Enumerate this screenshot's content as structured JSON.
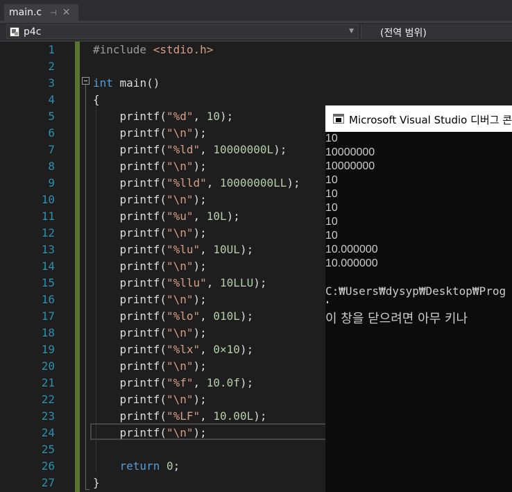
{
  "tab": {
    "filename": "main.c",
    "pin_glyph": "⊣",
    "close_glyph": "✕"
  },
  "nav": {
    "project": "p4c",
    "scope": "(전역 범위)"
  },
  "editor": {
    "line_numbers": [
      "1",
      "2",
      "3",
      "4",
      "5",
      "6",
      "7",
      "8",
      "9",
      "10",
      "11",
      "12",
      "13",
      "14",
      "15",
      "16",
      "17",
      "18",
      "19",
      "20",
      "21",
      "22",
      "23",
      "24",
      "25",
      "26",
      "27"
    ],
    "code": {
      "l1_pp": "#include ",
      "l1_file": "<stdio.h>",
      "l3_kw": "int",
      "l3_rest": " main()",
      "l4": "{",
      "printf": "printf",
      "l5_a": "(",
      "l5_str": "\"%d\"",
      "l5_b": ", ",
      "l5_num": "10",
      "l5_c": ");",
      "nl_str": "\"\\n\"",
      "l7_str": "\"%ld\"",
      "l7_num": "10000000L",
      "l9_str": "\"%lld\"",
      "l9_num": "10000000LL",
      "l11_str": "\"%u\"",
      "l11_num": "10L",
      "l13_str": "\"%lu\"",
      "l13_num": "10UL",
      "l15_str": "\"%llu\"",
      "l15_num": "10LLU",
      "l17_str": "\"%lo\"",
      "l17_num": "010L",
      "l19_str": "\"%lx\"",
      "l19_num": "0×10",
      "l21_str": "\"%f\"",
      "l21_num": "10.0f",
      "l23_str": "\"%LF\"",
      "l23_num": "10.00L",
      "l26_kw": "return",
      "l26_num": "0",
      "l27": "}"
    }
  },
  "console": {
    "title": "Microsoft Visual Studio 디버그 콘솔",
    "output": [
      "10",
      "10000000",
      "10000000",
      "10",
      "10",
      "10",
      "10",
      "10",
      "10.000000",
      "10.000000"
    ],
    "path": "C:₩Users₩dysyp₩Desktop₩Prog",
    "message": "이 창을 닫으려면 아무 키나"
  }
}
